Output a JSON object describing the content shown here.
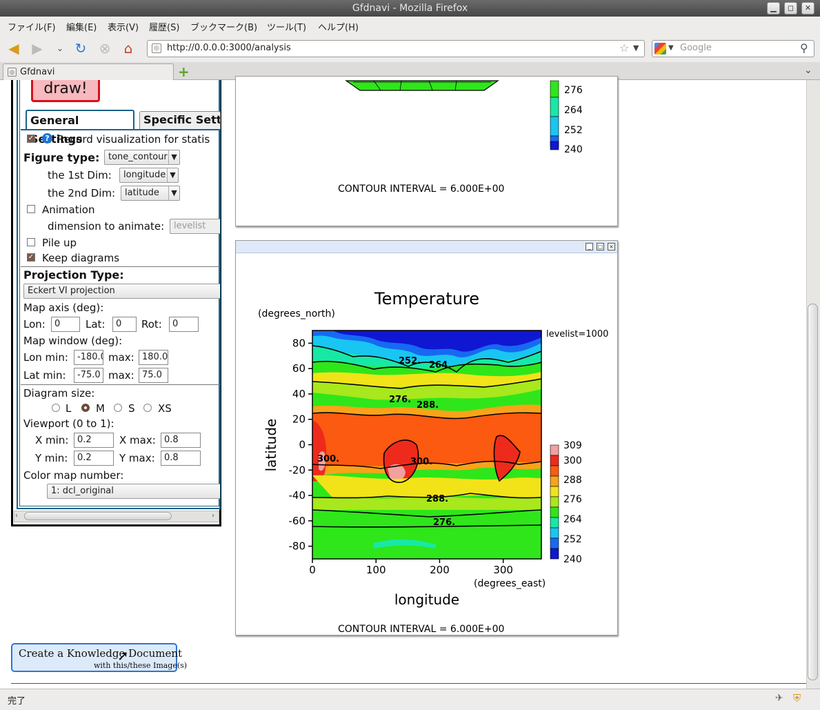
{
  "window": {
    "title": "Gfdnavi - Mozilla Firefox"
  },
  "menu": [
    "ファイル(F)",
    "編集(E)",
    "表示(V)",
    "履歴(S)",
    "ブックマーク(B)",
    "ツール(T)",
    "ヘルプ(H)"
  ],
  "nav": {
    "url": "http://0.0.0.0:3000/analysis",
    "search_placeholder": "Google"
  },
  "tabs": [
    {
      "label": "Gfdnavi"
    }
  ],
  "status": {
    "text": "完了"
  },
  "panel": {
    "draw_label": "draw!",
    "tab_general": "General Settings",
    "tab_specific": "Specific Sett",
    "record_label": "Record visualization for statis",
    "figure_type_label": "Figure type:",
    "figure_type_value": "tone_contour",
    "dim1_label": "the 1st Dim:",
    "dim1_value": "longitude",
    "dim2_label": "the 2nd Dim:",
    "dim2_value": "latitude",
    "animation_label": "Animation",
    "animate_dim_label": "dimension to animate:",
    "animate_dim_value": "levelist",
    "pileup_label": "Pile up",
    "keep_label": "Keep diagrams",
    "projection_label": "Projection Type:",
    "projection_value": "Eckert VI projection",
    "map_axis_label": "Map axis (deg):",
    "lon_label": "Lon:",
    "lon_value": "0",
    "lat_label": "Lat:",
    "lat_value": "0",
    "rot_label": "Rot:",
    "rot_value": "0",
    "map_window_label": "Map window (deg):",
    "lonmin_label": "Lon min:",
    "lonmin_value": "-180.0",
    "lonmax_label": "max:",
    "lonmax_value": "180.0",
    "latmin_label": "Lat min:",
    "latmin_value": "-75.0",
    "latmax_label": "max:",
    "latmax_value": "75.0",
    "diagram_size_label": "Diagram size:",
    "size_options": [
      "L",
      "M",
      "S",
      "XS"
    ],
    "viewport_label": "Viewport (0 to 1):",
    "xmin_label": "X min:",
    "xmin_value": "0.2",
    "xmax_label": "X max:",
    "xmax_value": "0.8",
    "ymin_label": "Y min:",
    "ymin_value": "0.2",
    "ymax_label": "Y max:",
    "ymax_value": "0.8",
    "colormap_label": "Color map number:",
    "colormap_value": "1: dcl_original"
  },
  "knowledge": {
    "line1": "Create a Knowledge Document",
    "line2": "with this/these Image(s)"
  },
  "plot_top": {
    "legend_values": [
      "276",
      "264",
      "252",
      "240"
    ],
    "contour_interval": "CONTOUR INTERVAL = 6.000E+00"
  },
  "chart_data": {
    "type": "heatmap",
    "title": "Temperature",
    "xlabel": "longitude",
    "ylabel": "latitude",
    "x_units": "(degrees_east)",
    "y_units": "(degrees_north)",
    "x_ticks": [
      0,
      100,
      200,
      300
    ],
    "y_ticks": [
      80,
      60,
      40,
      20,
      0,
      -20,
      -40,
      -60,
      -80
    ],
    "xlim": [
      0,
      360
    ],
    "ylim": [
      -90,
      90
    ],
    "annotation": "levelist=1000",
    "contour_labels": [
      "252.",
      "264.",
      "276.",
      "288.",
      "300.",
      "300.",
      "288.",
      "276."
    ],
    "colorbar_ticks": [
      "309",
      "300",
      "288",
      "276",
      "264",
      "252",
      "240"
    ],
    "colorbar_colors": [
      "#f2a0a0",
      "#ee2a1c",
      "#fb5a10",
      "#f9a319",
      "#f1e318",
      "#a8e81c",
      "#2fe61a",
      "#18e8a6",
      "#18c6f1",
      "#1769f1",
      "#0f17d2"
    ],
    "contour_interval": "CONTOUR INTERVAL = 6.000E+00"
  }
}
